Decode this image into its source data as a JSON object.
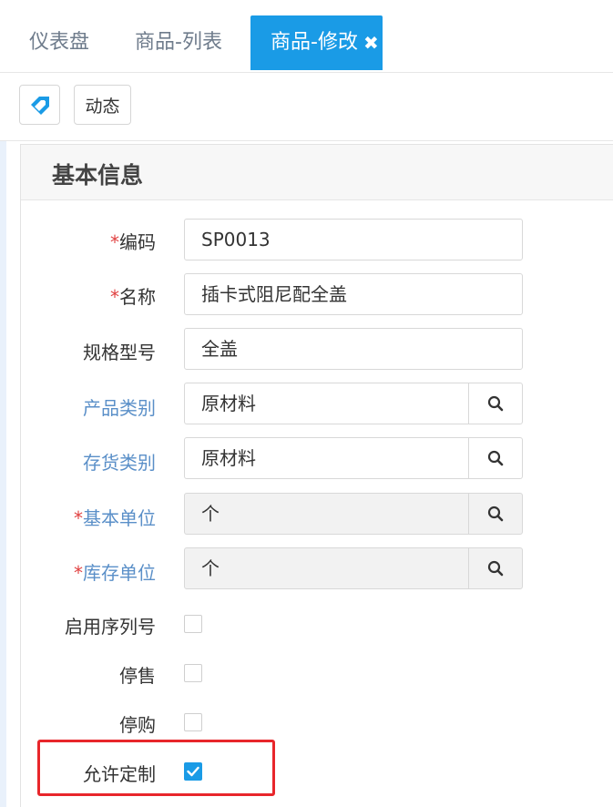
{
  "tabs": [
    {
      "label": "仪表盘"
    },
    {
      "label": "商品-列表"
    },
    {
      "label": "商品-修改",
      "active": true
    }
  ],
  "toolbar": {
    "tag_icon": "tag-icon",
    "dynamic_label": "动态"
  },
  "panel": {
    "title": "基本信息"
  },
  "form": {
    "code": {
      "label": "编码",
      "required": "*",
      "value": "SP0013"
    },
    "name": {
      "label": "名称",
      "required": "*",
      "value": "插卡式阻尼配全盖"
    },
    "spec": {
      "label": "规格型号",
      "value": "全盖"
    },
    "product_category": {
      "label": "产品类别",
      "value": "原材料"
    },
    "inventory_category": {
      "label": "存货类别",
      "value": "原材料"
    },
    "base_unit": {
      "label": "基本单位",
      "required": "*",
      "value": "个"
    },
    "stock_unit": {
      "label": "库存单位",
      "required": "*",
      "value": "个"
    },
    "enable_serial": {
      "label": "启用序列号",
      "checked": false
    },
    "stop_sale": {
      "label": "停售",
      "checked": false
    },
    "stop_purchase": {
      "label": "停购",
      "checked": false
    },
    "allow_custom": {
      "label": "允许定制",
      "checked": true
    }
  },
  "colors": {
    "accent": "#1a9be6",
    "link_label": "#5a8fc8",
    "required": "#e04040",
    "highlight": "#e8262b"
  }
}
